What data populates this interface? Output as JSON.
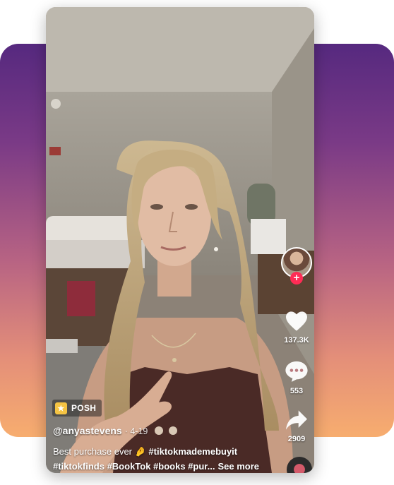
{
  "video": {
    "badge_label": "POSH",
    "author": "@anyastevens",
    "date": "· 4-19",
    "description_line1_plain": "Best purchase ever 🤌 ",
    "description_line1_tag": "#tiktokmademebuyit",
    "description_line2": "#tiktokfinds #BookTok #books #pur...",
    "see_more": "See more"
  },
  "actions": {
    "likes": "137.3K",
    "comments": "553",
    "shares": "2909",
    "follow_label": "+"
  },
  "colors": {
    "gradient_top": "#56297f",
    "gradient_bottom": "#f7ad6f",
    "follow_red": "#fe2c55",
    "badge_yellow": "#f5c443"
  },
  "icons": [
    "heart-icon",
    "comment-icon",
    "share-icon",
    "music-disc-icon",
    "shop-bag-icon"
  ]
}
